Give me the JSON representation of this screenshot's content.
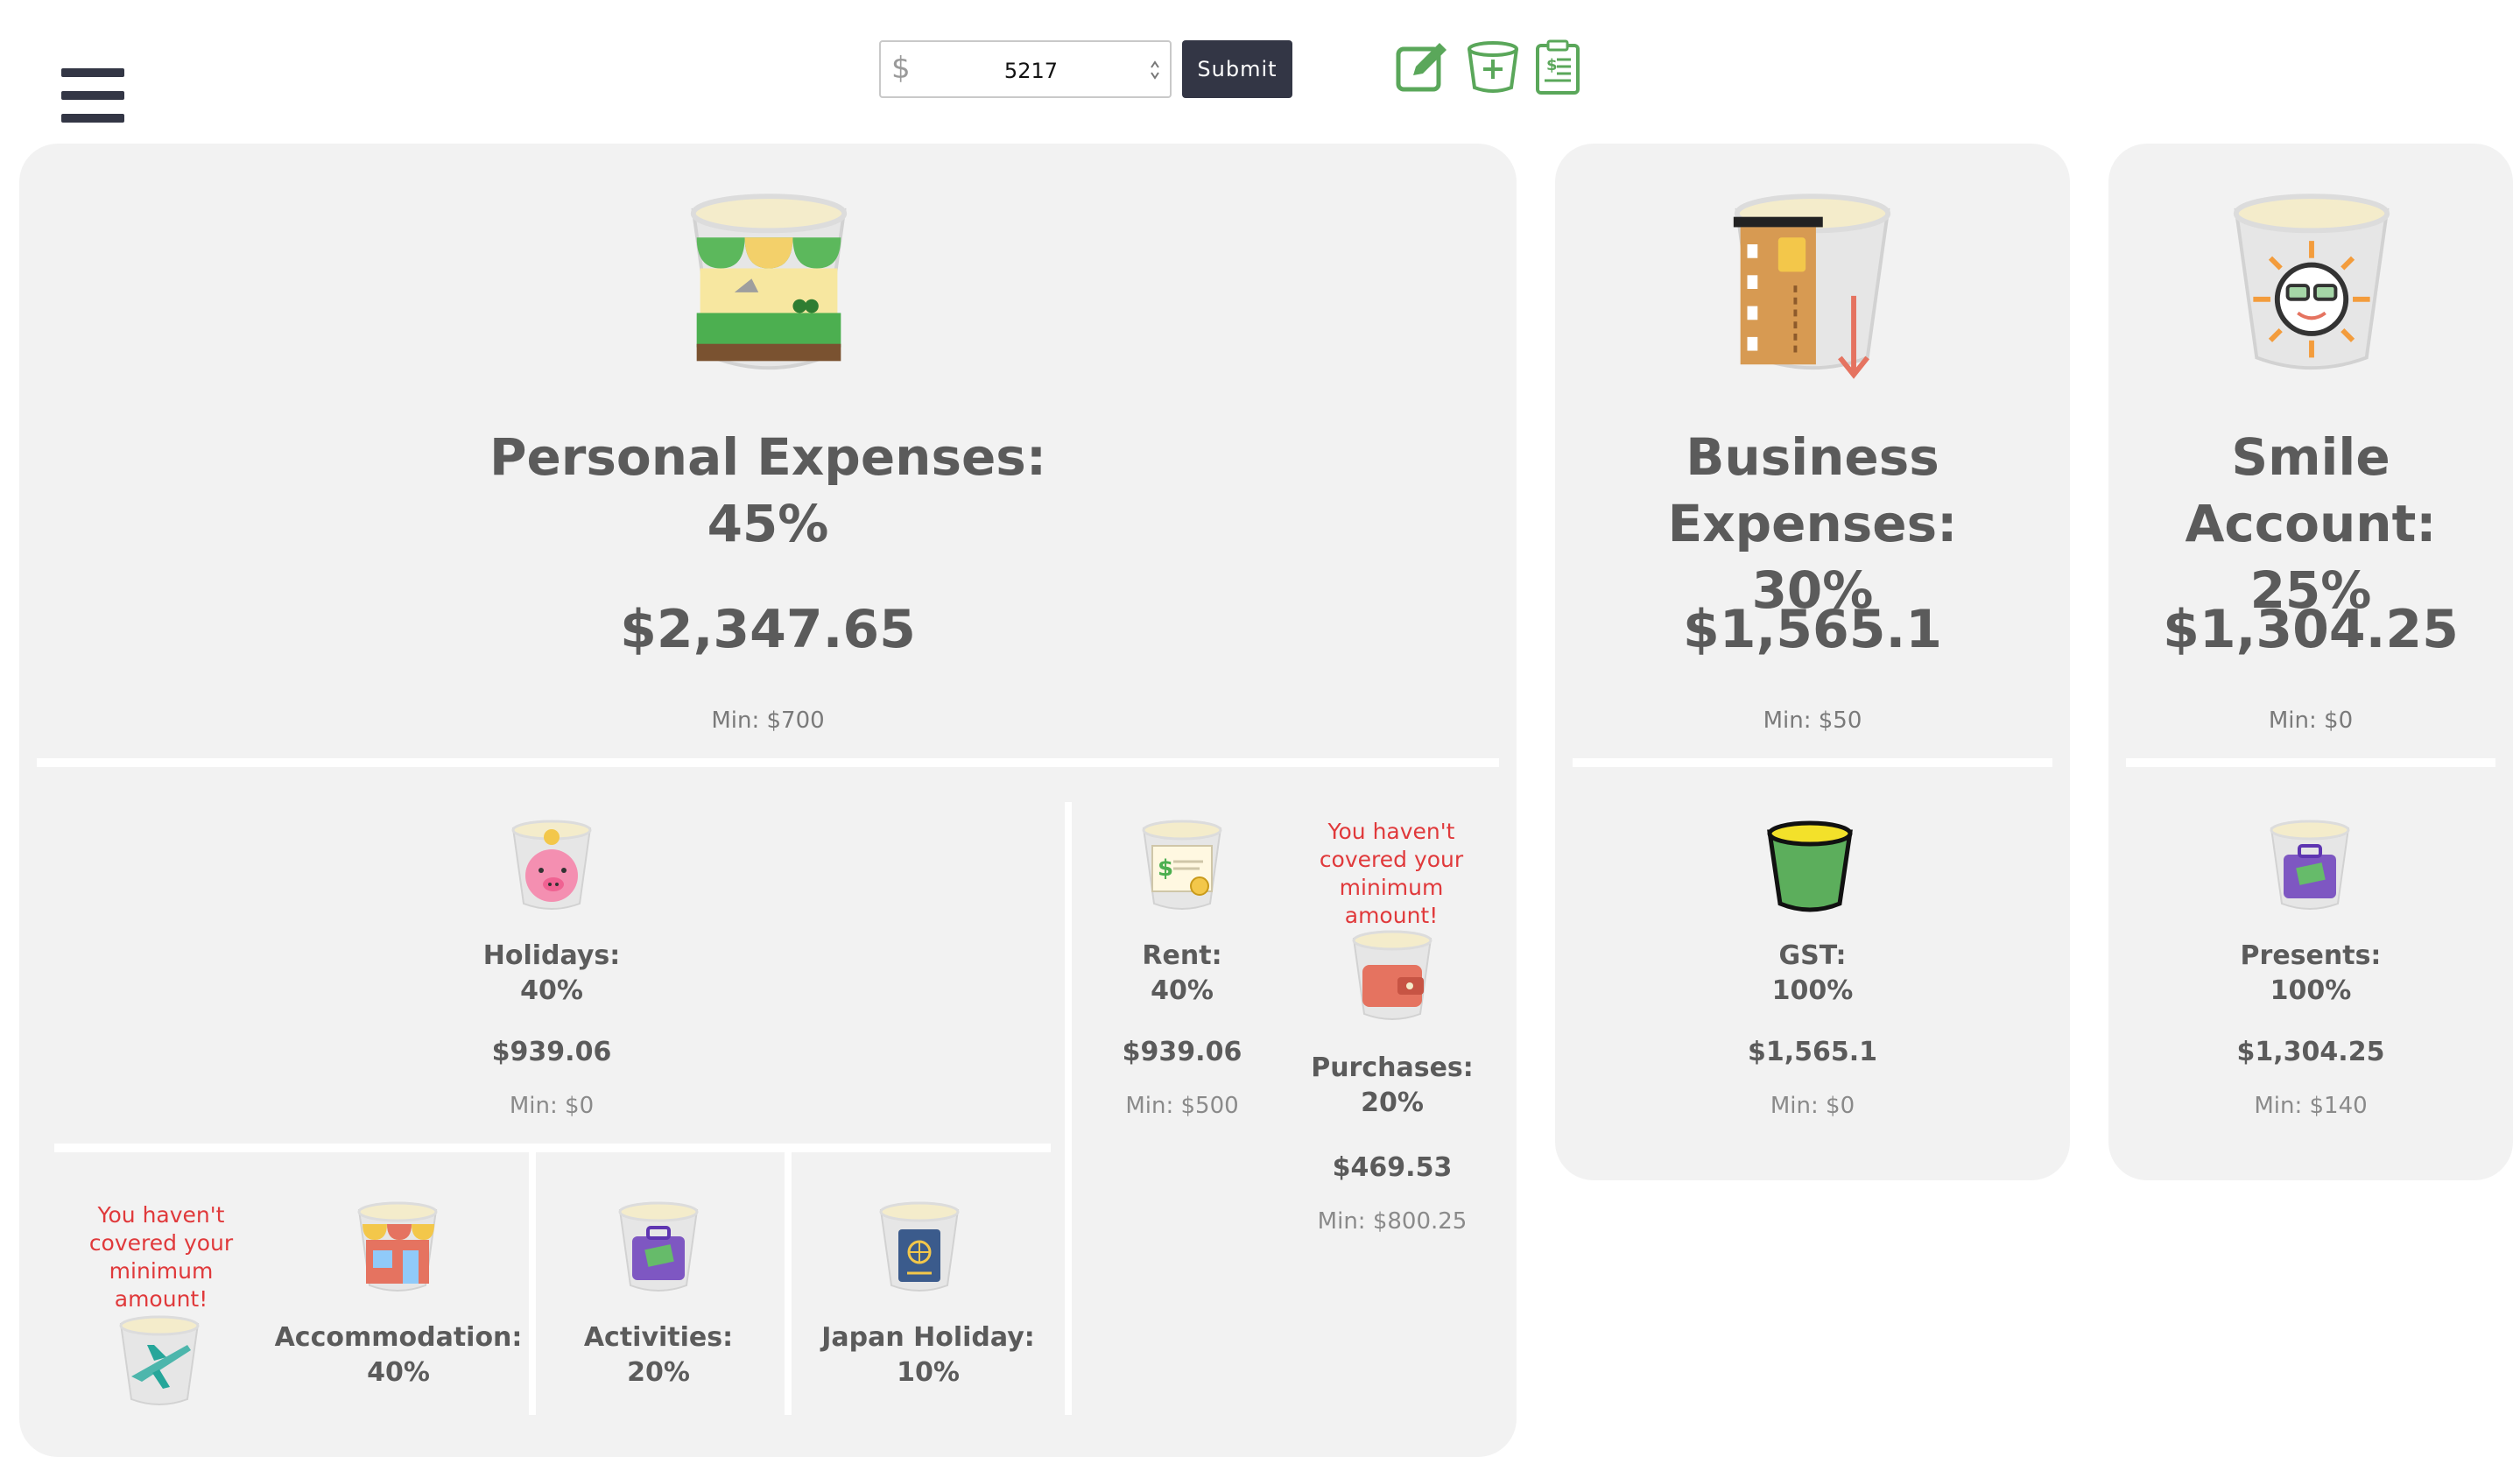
{
  "header": {
    "currency_symbol": "$",
    "amount_value": "5217",
    "submit_label": "Submit",
    "tools": [
      {
        "icon": "edit-icon",
        "color": "#5aa75a"
      },
      {
        "icon": "add-bucket-icon",
        "color": "#5aa75a"
      },
      {
        "icon": "report-icon",
        "color": "#5aa75a"
      }
    ]
  },
  "colors": {
    "card_bg": "#f2f2f2",
    "dark": "#333645",
    "warning": "#e0393b",
    "text": "#5b5b5b"
  },
  "buckets": {
    "personal": {
      "title": "Personal Expenses:",
      "percent": "45%",
      "amount": "$2,347.65",
      "min": "Min: $700",
      "icon": "market-stall-icon"
    },
    "business": {
      "title": "Business Expenses:",
      "percent": "30%",
      "amount": "$1,565.1",
      "min": "Min: $50",
      "icon": "credit-card-icon"
    },
    "smile": {
      "title": "Smile Account:",
      "percent": "25%",
      "amount": "$1,304.25",
      "min": "Min: $0",
      "icon": "smiling-sun-icon"
    }
  },
  "sub_buckets": {
    "holidays": {
      "title": "Holidays:",
      "percent": "40%",
      "amount": "$939.06",
      "min": "Min: $0",
      "icon": "piggy-bank-icon"
    },
    "rent": {
      "title": "Rent:",
      "percent": "40%",
      "amount": "$939.06",
      "min": "Min: $500",
      "icon": "certificate-icon"
    },
    "purchases": {
      "warning": "You haven't covered your minimum amount!",
      "title": "Purchases:",
      "percent": "20%",
      "amount": "$469.53",
      "min": "Min: $800.25",
      "icon": "wallet-icon"
    },
    "gst": {
      "title": "GST:",
      "percent": "100%",
      "amount": "$1,565.1",
      "min": "Min: $0",
      "icon": "green-bucket-icon"
    },
    "presents": {
      "title": "Presents:",
      "percent": "100%",
      "amount": "$1,304.25",
      "min": "Min: $140",
      "icon": "suitcase-icon"
    },
    "flights": {
      "warning": "You haven't covered your minimum amount!",
      "icon": "airplane-icon"
    },
    "accommodation": {
      "title": "Accommodation:",
      "percent": "40%",
      "icon": "shop-icon"
    },
    "activities": {
      "title": "Activities:",
      "percent": "20%",
      "icon": "suitcase-icon"
    },
    "japan": {
      "title": "Japan Holiday:",
      "percent": "10%",
      "icon": "passport-icon"
    }
  }
}
